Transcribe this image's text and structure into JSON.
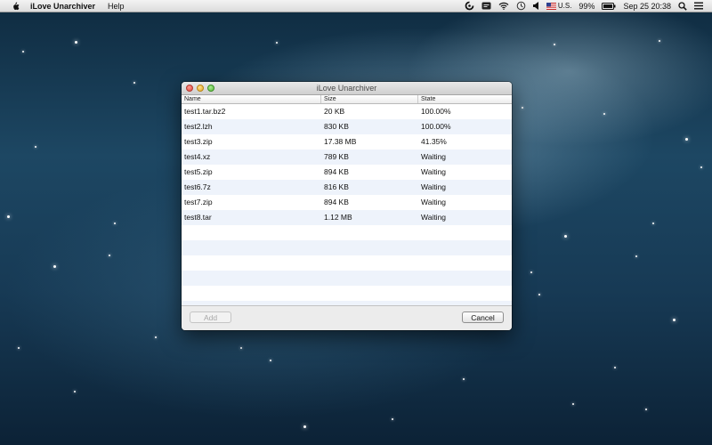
{
  "menubar": {
    "app_name": "iLove Unarchiver",
    "items": [
      "Help"
    ],
    "input_source": "U.S.",
    "battery": "99%",
    "clock": "Sep 25  20:38"
  },
  "window": {
    "title": "iLove Unarchiver",
    "columns": [
      "Name",
      "Size",
      "State"
    ],
    "rows": [
      {
        "name": "test1.tar.bz2",
        "size": "20 KB",
        "state": "100.00%"
      },
      {
        "name": "test2.lzh",
        "size": "830 KB",
        "state": "100.00%"
      },
      {
        "name": "test3.zip",
        "size": "17.38 MB",
        "state": "41.35%"
      },
      {
        "name": "test4.xz",
        "size": "789 KB",
        "state": "Waiting"
      },
      {
        "name": "test5.zip",
        "size": "894 KB",
        "state": "Waiting"
      },
      {
        "name": "test6.7z",
        "size": "816 KB",
        "state": "Waiting"
      },
      {
        "name": "test7.zip",
        "size": "894 KB",
        "state": "Waiting"
      },
      {
        "name": "test8.tar",
        "size": "1.12 MB",
        "state": "Waiting"
      }
    ],
    "add_label": "Add",
    "cancel_label": "Cancel"
  },
  "icons": {
    "apple": "apple-icon",
    "creative_cloud": "creative-cloud-icon",
    "messages": "message-icon",
    "wifi": "wifi-icon",
    "time_machine": "time-machine-icon",
    "volume": "volume-icon",
    "flag": "us-flag-icon",
    "battery": "battery-icon",
    "search": "spotlight-search-icon",
    "list": "notification-center-icon"
  }
}
